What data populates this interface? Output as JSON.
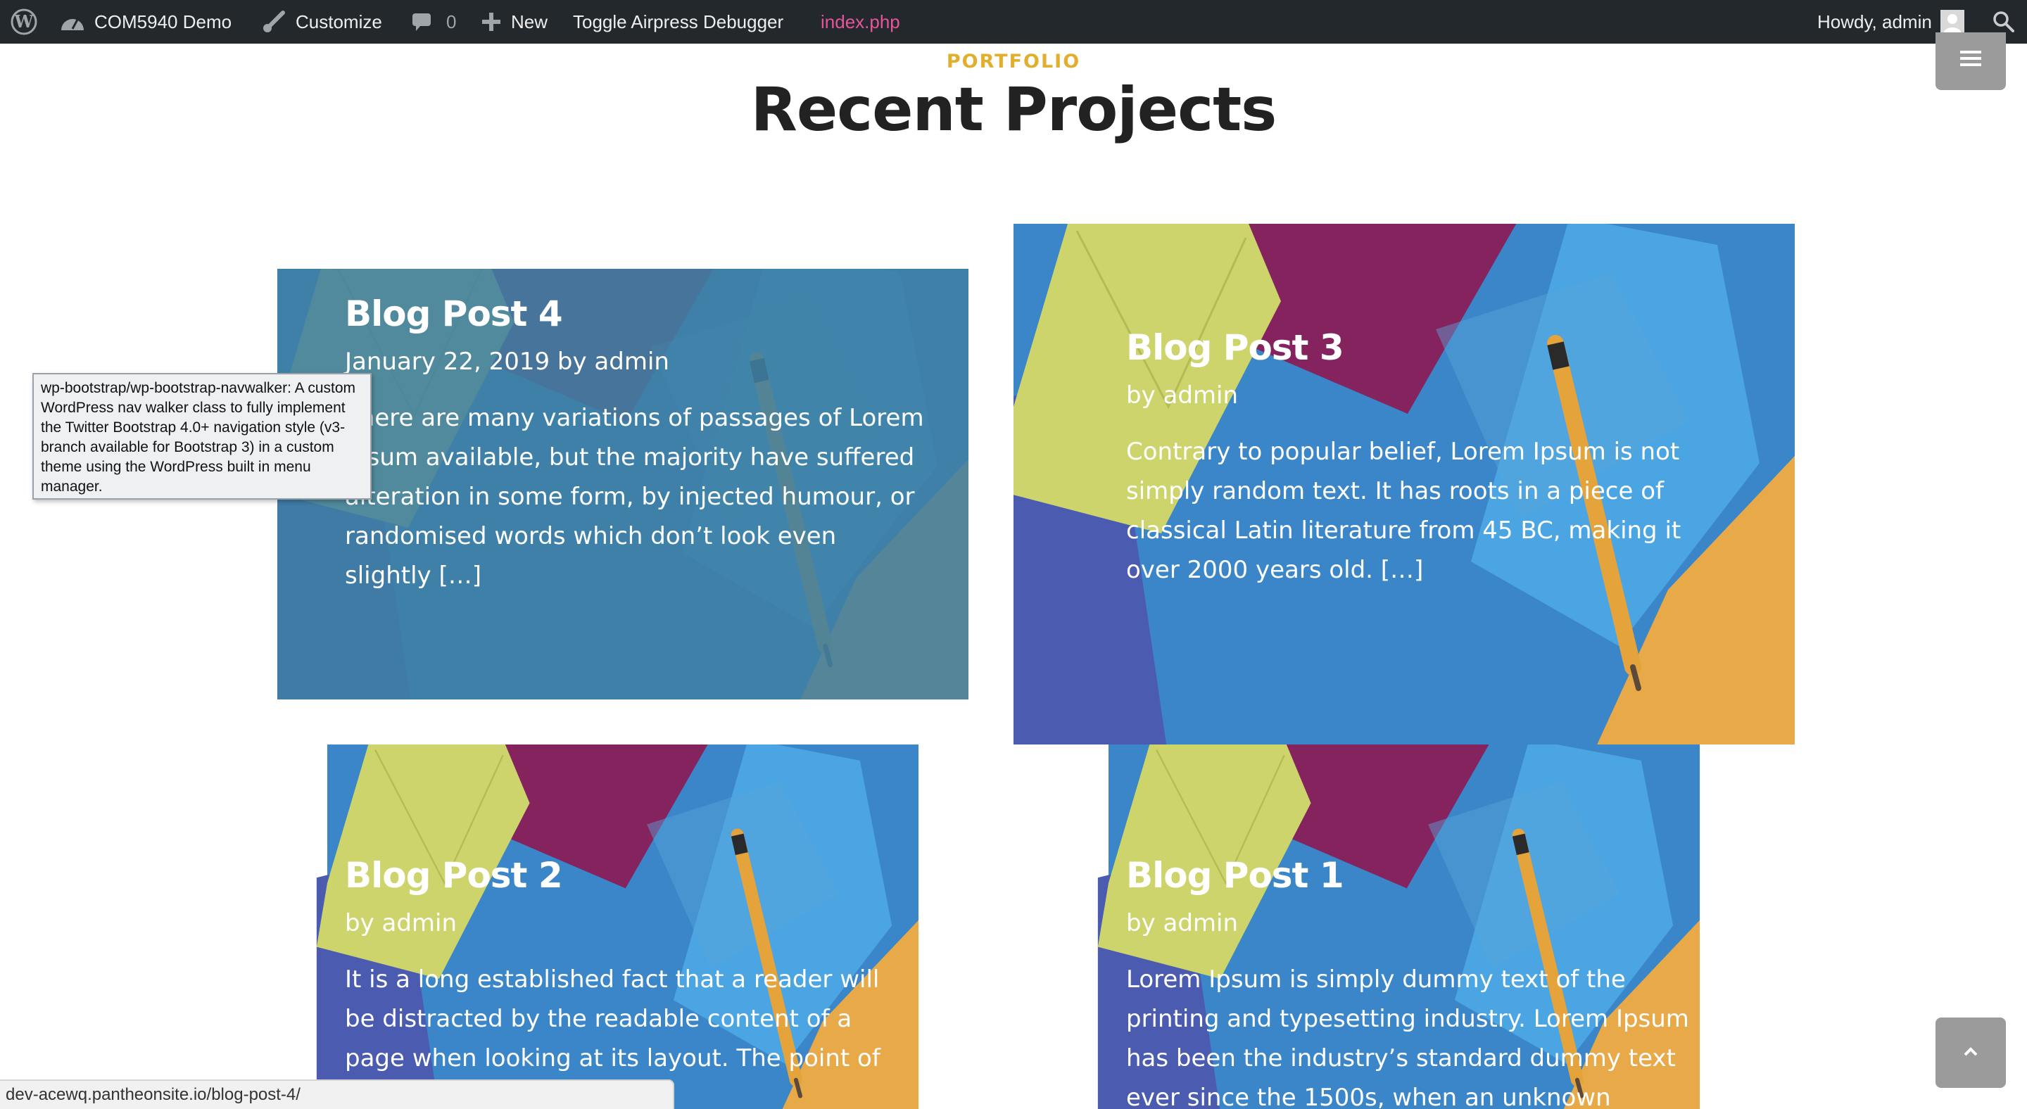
{
  "adminbar": {
    "wp_logo_icon": "wordpress-logo-icon",
    "site_name": "COM5940 Demo",
    "customize": "Customize",
    "comments_count": "0",
    "new": "New",
    "toggle_debugger": "Toggle Airpress Debugger",
    "current_file": "index.php",
    "howdy": "Howdy, admin",
    "colors": {
      "bar": "#23282d",
      "file_link": "#e5559b"
    }
  },
  "section": {
    "eyebrow": "PORTFOLIO",
    "title": "Recent Projects",
    "accent": "#e2ae2d"
  },
  "posts": [
    {
      "title": "Blog Post 4",
      "meta": "January 22, 2019 by admin",
      "excerpt": "There are many variations of passages of Lorem Ipsum available, but the majority have suffered alteration in some form, by injected humour, or randomised words which don’t look even slightly […]",
      "state": "hovered"
    },
    {
      "title": "Blog Post 3",
      "meta": "by admin",
      "excerpt": "Contrary to popular belief, Lorem Ipsum is not simply random text. It has roots in a piece of classical Latin literature from 45 BC, making it over 2000 years old. […]"
    },
    {
      "title": "Blog Post 2",
      "meta": "by admin",
      "excerpt": "It is a long established fact that a reader will be distracted by the readable content of a page when looking at its layout. The point of using Lorem"
    },
    {
      "title": "Blog Post 1",
      "meta": "by admin",
      "excerpt": "Lorem Ipsum is simply dummy text of the printing and typesetting industry. Lorem Ipsum has been the industry’s standard dummy text ever since the 1500s, when an unknown printer took […]"
    }
  ],
  "tooltip": {
    "text": "wp-bootstrap/wp-bootstrap-navwalker: A custom WordPress nav walker class to fully implement the Twitter Bootstrap 4.0+ navigation style (v3-branch available for Bootstrap 3) in a custom theme using the WordPress built in menu manager."
  },
  "statusbar": {
    "url": "dev-acewq.pantheonsite.io/blog-post-4/"
  },
  "icons": {
    "menu": "hamburger-menu-icon",
    "scroll_top": "chevron-up-icon",
    "search": "search-icon"
  }
}
